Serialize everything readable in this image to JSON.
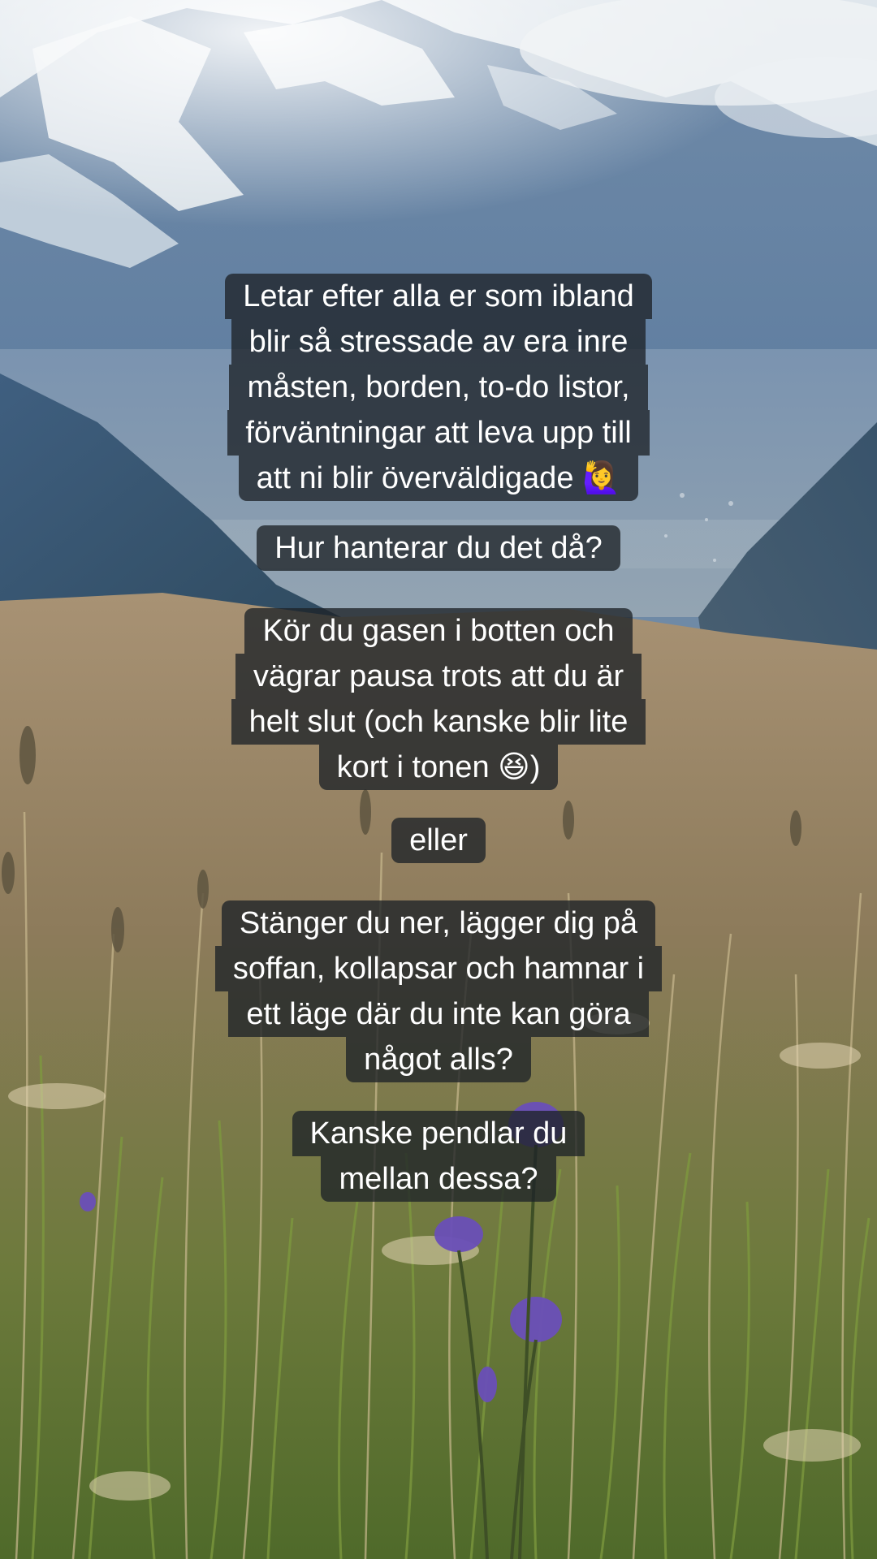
{
  "scene": {
    "description_icon": "mountain-meadow-photo",
    "sky_color": "#c9d6e0",
    "mountain_color": "#4f6e91",
    "meadow_color": "#8a7a5c",
    "grass_color": "#6f8f3a",
    "flower_color": "#6a4fb8"
  },
  "captions": [
    {
      "lines": [
        "Letar efter alla er som ibland",
        "blir så stressade av era inre",
        "måsten, borden, to-do listor,",
        "förväntningar att leva upp till",
        "att ni blir överväldigade 🙋‍♀️"
      ]
    },
    {
      "lines": [
        "Hur hanterar du det då?"
      ]
    },
    {
      "lines": [
        "Kör du gasen i botten och",
        "vägrar pausa trots att du är",
        "helt slut (och kanske blir lite",
        "kort i tonen 😆)"
      ]
    },
    {
      "lines": [
        "eller"
      ]
    },
    {
      "lines": [
        "Stänger du ner, lägger dig på",
        "soffan, kollapsar och hamnar i",
        "ett läge där du inte kan göra",
        "något alls?"
      ]
    },
    {
      "lines": [
        "Kanske pendlar du",
        "mellan dessa?"
      ]
    }
  ]
}
